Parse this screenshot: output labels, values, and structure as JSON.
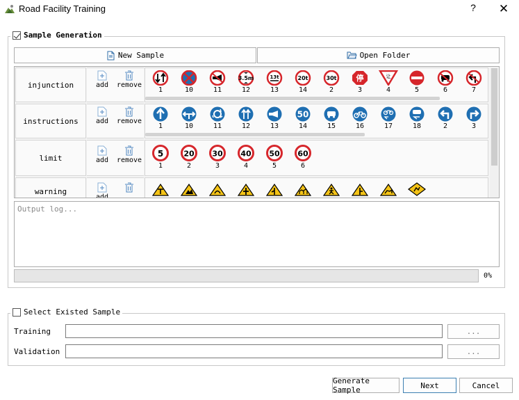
{
  "window": {
    "title": "Road Facility Training",
    "help": "?",
    "close": "✕"
  },
  "sample_generation": {
    "legend": "Sample Generation",
    "checked": true,
    "new_sample": "New Sample",
    "open_folder": "Open Folder",
    "tools": {
      "add": "add",
      "remove": "remove"
    },
    "rows": [
      {
        "label": "injunction",
        "numbers": [
          "1",
          "10",
          "11",
          "12",
          "13",
          "14",
          "2",
          "3",
          "4",
          "5",
          "6",
          "7"
        ]
      },
      {
        "label": "instructions",
        "numbers": [
          "1",
          "10",
          "11",
          "12",
          "13",
          "14",
          "15",
          "16",
          "17",
          "18",
          "2",
          "3"
        ]
      },
      {
        "label": "limit",
        "numbers": [
          "1",
          "2",
          "3",
          "4",
          "5",
          "6"
        ],
        "sign_text": [
          "5",
          "20",
          "30",
          "40",
          "50",
          "60"
        ]
      },
      {
        "label": "warning",
        "numbers": []
      }
    ],
    "sign_glyphs": {
      "inj_12": "3.5m",
      "inj_13": "13t",
      "inj_14": "20t",
      "inj_2": "30t",
      "inj_3": "停",
      "inj_4": "让",
      "ins_14": "50"
    },
    "output_placeholder": "Output log...",
    "progress_value": 0,
    "progress_text": "0%"
  },
  "existed_sample": {
    "legend": "Select Existed Sample",
    "checked": false,
    "training_label": "Training",
    "validation_label": "Validation",
    "browse_label": "..."
  },
  "footer": {
    "generate": "Generate Sample",
    "next": "Next",
    "cancel": "Cancel"
  },
  "colors": {
    "prohibit_red": "#d6262b",
    "instruct_blue": "#1f6fb2",
    "warning_yellow": "#f4c316",
    "focus_blue": "#3c7fb1"
  }
}
